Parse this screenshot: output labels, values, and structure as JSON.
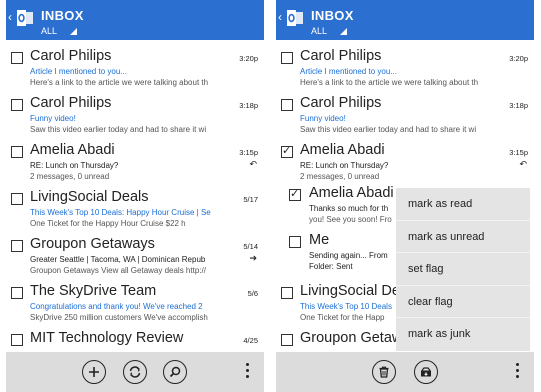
{
  "left": {
    "header": {
      "title": "INBOX",
      "filter": "ALL"
    },
    "messages": [
      {
        "sender": "Carol Philips",
        "subject": "Article I mentioned to you...",
        "preview": "Here's a link to the article we were talking about th",
        "time": "3:20p",
        "checked": false
      },
      {
        "sender": "Carol Philips",
        "subject": "Funny video!",
        "preview": "Saw this video earlier today and had to share it wi",
        "time": "3:18p",
        "checked": false
      },
      {
        "sender": "Amelia Abadi",
        "subject": "RE: Lunch on Thursday?",
        "preview": "2 messages, 0 unread",
        "time": "3:15p",
        "checked": false,
        "icon": "reply-icon"
      },
      {
        "sender": "LivingSocial Deals",
        "subject": "This Week's Top 10 Deals: Happy Hour Cruise | Se",
        "preview": "One Ticket for the Happy Hour Cruise   $22    h",
        "time": "5/17",
        "checked": false
      },
      {
        "sender": "Groupon Getaways",
        "subject": "Greater Seattle | Tacoma, WA | Dominican Repub",
        "preview": "Groupon Getaways View all Getaway deals http://",
        "time": "5/14",
        "checked": false,
        "icon": "forward-icon"
      },
      {
        "sender": "The SkyDrive Team",
        "subject": "Congratulations and thank you! We've reached 2",
        "preview": "SkyDrive 250 million customers We've accomplish",
        "time": "5/6",
        "checked": false
      },
      {
        "sender": "MIT Technology Review",
        "subject": "",
        "preview": "",
        "time": "4/25",
        "checked": false
      }
    ]
  },
  "right": {
    "header": {
      "title": "INBOX",
      "filter": "ALL"
    },
    "messages": [
      {
        "sender": "Carol Philips",
        "subject": "Article I mentioned to you...",
        "preview": "Here's a link to the article we were talking about th",
        "time": "3:20p",
        "checked": false
      },
      {
        "sender": "Carol Philips",
        "subject": "Funny video!",
        "preview": "Saw this video earlier today and had to share it wi",
        "time": "3:18p",
        "checked": false
      },
      {
        "sender": "Amelia Abadi",
        "subject": "RE: Lunch on Thursday?",
        "preview": "2 messages, 0 unread",
        "time": "3:15p",
        "checked": true,
        "icon": "reply-icon"
      },
      {
        "sender": "Amelia Abadi",
        "subject": "Thanks so much for th",
        "preview": "you! See you soon! Fro",
        "time": "",
        "checked": true,
        "indent": true
      },
      {
        "sender": "Me",
        "subject": "Sending again... From",
        "preview": "Folder: Sent",
        "time": "",
        "checked": false,
        "indent": true
      },
      {
        "sender": "LivingSocial Deals",
        "subject": "This Week's Top 10 Deals",
        "preview": "One Ticket for the Happ",
        "time": "",
        "checked": false
      },
      {
        "sender": "Groupon Getaw",
        "subject": "",
        "preview": "",
        "time": "",
        "checked": false
      }
    ],
    "context_menu": [
      "mark as read",
      "mark as unread",
      "set flag",
      "clear flag",
      "mark as junk"
    ]
  },
  "icons": {
    "left_appbar": [
      "new-mail-icon",
      "sync-icon",
      "search-icon"
    ],
    "right_appbar": [
      "delete-icon",
      "move-icon"
    ]
  },
  "colors": {
    "header": "#2b6fd0",
    "subject_blue": "#1a6fd6",
    "appbar": "#dcdcdc",
    "menu": "#e4e4e4"
  }
}
